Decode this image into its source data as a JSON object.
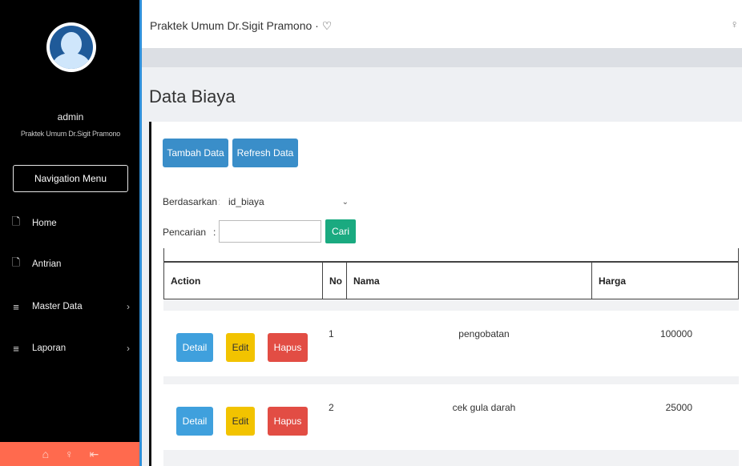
{
  "sidebar": {
    "username": "admin",
    "subtitle": "Praktek Umum Dr.Sigit Pramono",
    "nav_menu_label": "Navigation Menu",
    "items": [
      {
        "label": "Home",
        "icon": "document-icon"
      },
      {
        "label": "Antrian",
        "icon": "document-icon"
      },
      {
        "label": "Master Data",
        "icon": "hamburger-icon",
        "has_submenu": true
      },
      {
        "label": "Laporan",
        "icon": "hamburger-icon",
        "has_submenu": true
      }
    ],
    "footer_icons": [
      "home-icon",
      "user-icon",
      "logout-icon"
    ]
  },
  "header": {
    "app_title": "Praktek Umum Dr.Sigit Pramono · ♡"
  },
  "page": {
    "title": "Data Biaya",
    "buttons": {
      "add": "Tambah Data",
      "refresh": "Refresh Data"
    },
    "filter": {
      "by_label": "Berdasarkan:",
      "by_value": "id_biaya",
      "search_label": "Pencarian",
      "search_separator": ":",
      "search_value": "",
      "search_button": "Cari"
    }
  },
  "table": {
    "columns": [
      "Action",
      "No",
      "Nama",
      "Harga"
    ],
    "row_actions": {
      "detail": "Detail",
      "edit": "Edit",
      "delete": "Hapus"
    },
    "rows": [
      {
        "no": "1",
        "nama": "pengobatan",
        "harga": "100000"
      },
      {
        "no": "2",
        "nama": "cek gula darah",
        "harga": "25000"
      }
    ]
  },
  "colors": {
    "sidebar_bg": "#000000",
    "accent_blue": "#3a8ec9",
    "btn_success": "#1aaa80",
    "btn_warning": "#f2c300",
    "btn_danger": "#e24d44",
    "footer_bg": "#ff6a4e"
  }
}
